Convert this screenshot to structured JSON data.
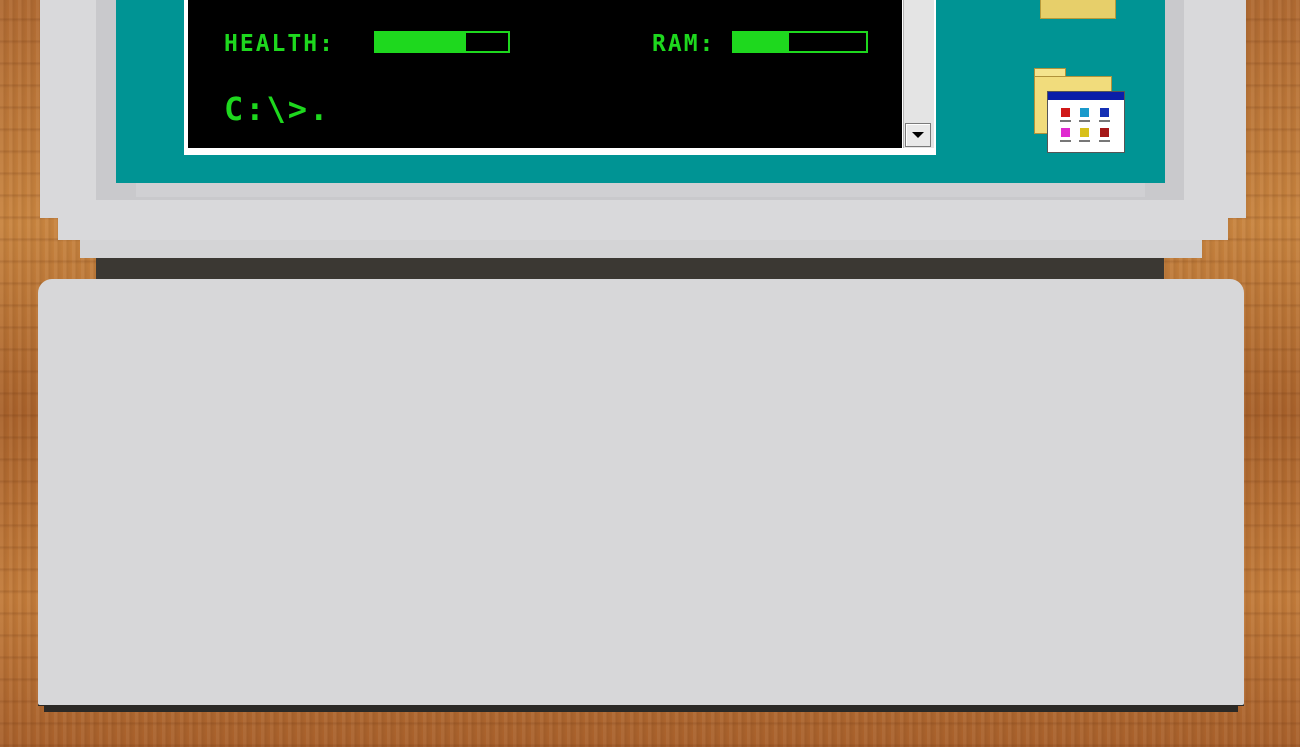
{
  "terminal": {
    "health_label": "HEALTH:",
    "health_level": 0.68,
    "ram_label": "RAM:",
    "ram_level": 0.42,
    "prompt": "C:\\>."
  },
  "colors": {
    "terminal_text": "#1ed81e",
    "screen_bg": "#009494",
    "terminal_bg": "#000000"
  },
  "desktop_icons": [
    {
      "name": "folder-icon"
    },
    {
      "name": "programs-folder-icon"
    }
  ]
}
